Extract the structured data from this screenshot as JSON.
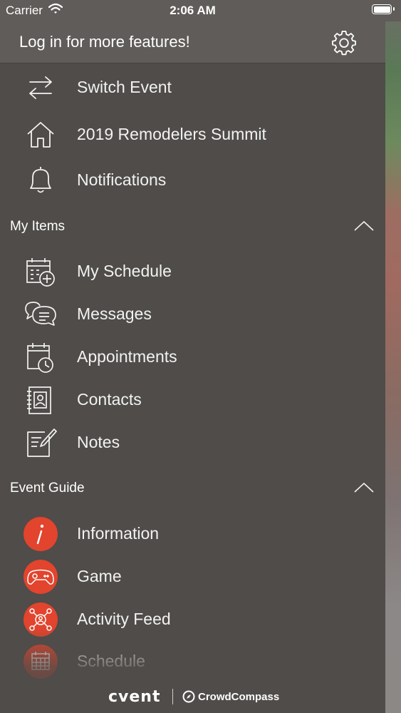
{
  "status_bar": {
    "carrier": "Carrier",
    "time": "2:06 AM"
  },
  "header": {
    "title": "Log in for more features!",
    "settings_icon": "gear-icon"
  },
  "top_items": [
    {
      "label": "Switch Event",
      "icon": "switch-arrows-icon"
    },
    {
      "label": "2019 Remodelers Summit",
      "icon": "home-icon"
    },
    {
      "label": "Notifications",
      "icon": "bell-icon"
    }
  ],
  "my_items": {
    "title": "My Items",
    "items": [
      {
        "label": "My Schedule",
        "icon": "calendar-add-icon"
      },
      {
        "label": "Messages",
        "icon": "chat-bubbles-icon"
      },
      {
        "label": "Appointments",
        "icon": "calendar-clock-icon"
      },
      {
        "label": "Contacts",
        "icon": "contact-book-icon"
      },
      {
        "label": "Notes",
        "icon": "note-pencil-icon"
      }
    ]
  },
  "event_guide": {
    "title": "Event Guide",
    "items": [
      {
        "label": "Information",
        "icon": "info-icon"
      },
      {
        "label": "Game",
        "icon": "gamepad-icon"
      },
      {
        "label": "Activity Feed",
        "icon": "activity-network-icon"
      },
      {
        "label": "Schedule",
        "icon": "calendar-grid-icon"
      }
    ]
  },
  "footer": {
    "brand_primary": "cvent",
    "brand_secondary": "CrowdCompass"
  },
  "colors": {
    "drawer_bg": "#4f4c49",
    "header_bg": "#5f5c59",
    "accent": "#e2442d"
  }
}
